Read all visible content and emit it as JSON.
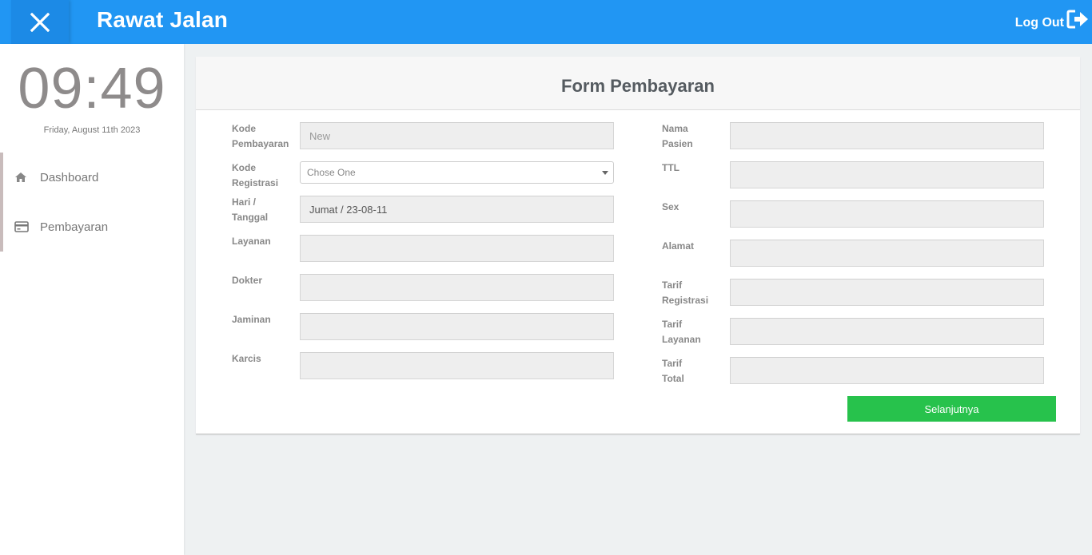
{
  "header": {
    "title": "Rawat Jalan",
    "logout_label": "Log Out"
  },
  "sidebar": {
    "clock": "09:49",
    "date": "Friday, August 11th 2023",
    "items": [
      {
        "label": "Dashboard",
        "icon": "home-icon"
      },
      {
        "label": "Pembayaran",
        "icon": "credit-card-icon"
      }
    ]
  },
  "form": {
    "title": "Form Pembayaran",
    "left": {
      "kode_pembayaran": {
        "label_1": "Kode",
        "label_2": "Pembayaran",
        "placeholder": "New"
      },
      "kode_registrasi": {
        "label_1": "Kode",
        "label_2": "Registrasi",
        "selected": "Chose One"
      },
      "hari_tanggal": {
        "label_1": "Hari /",
        "label_2": "Tanggal",
        "value": "Jumat / 23-08-11"
      },
      "layanan": {
        "label": "Layanan",
        "value": ""
      },
      "dokter": {
        "label": "Dokter",
        "value": ""
      },
      "jaminan": {
        "label": "Jaminan",
        "value": ""
      },
      "karcis": {
        "label": "Karcis",
        "value": ""
      }
    },
    "right": {
      "nama_pasien": {
        "label_1": "Nama",
        "label_2": "Pasien",
        "value": ""
      },
      "ttl": {
        "label": "TTL",
        "value": ""
      },
      "sex": {
        "label": "Sex",
        "value": ""
      },
      "alamat": {
        "label": "Alamat",
        "value": ""
      },
      "tarif_registrasi": {
        "label_1": "Tarif",
        "label_2": "Registrasi",
        "value": ""
      },
      "tarif_layanan": {
        "label_1": "Tarif",
        "label_2": "Layanan",
        "value": ""
      },
      "tarif_total": {
        "label_1": "Tarif",
        "label_2": "Total",
        "value": ""
      }
    },
    "submit_label": "Selanjutnya"
  },
  "colors": {
    "topbar": "#2196f3",
    "button_green": "#27c24c"
  }
}
